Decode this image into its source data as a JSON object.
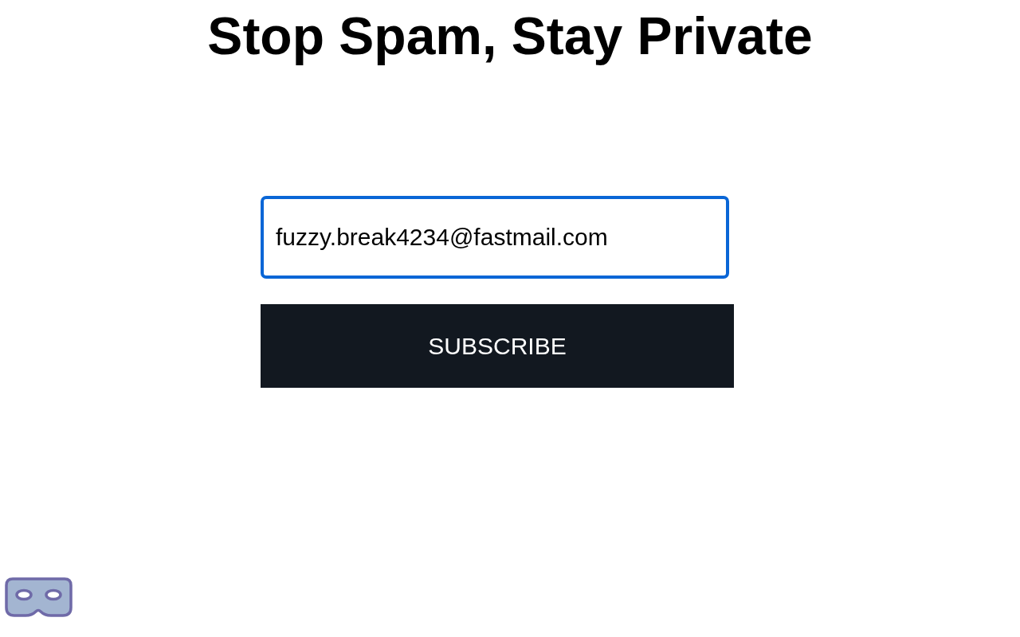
{
  "heading": "Stop Spam, Stay Private",
  "email_field": {
    "value": "fuzzy.break4234@fastmail.com",
    "focused": true
  },
  "subscribe_button": {
    "label": "SUBSCRIBE"
  }
}
